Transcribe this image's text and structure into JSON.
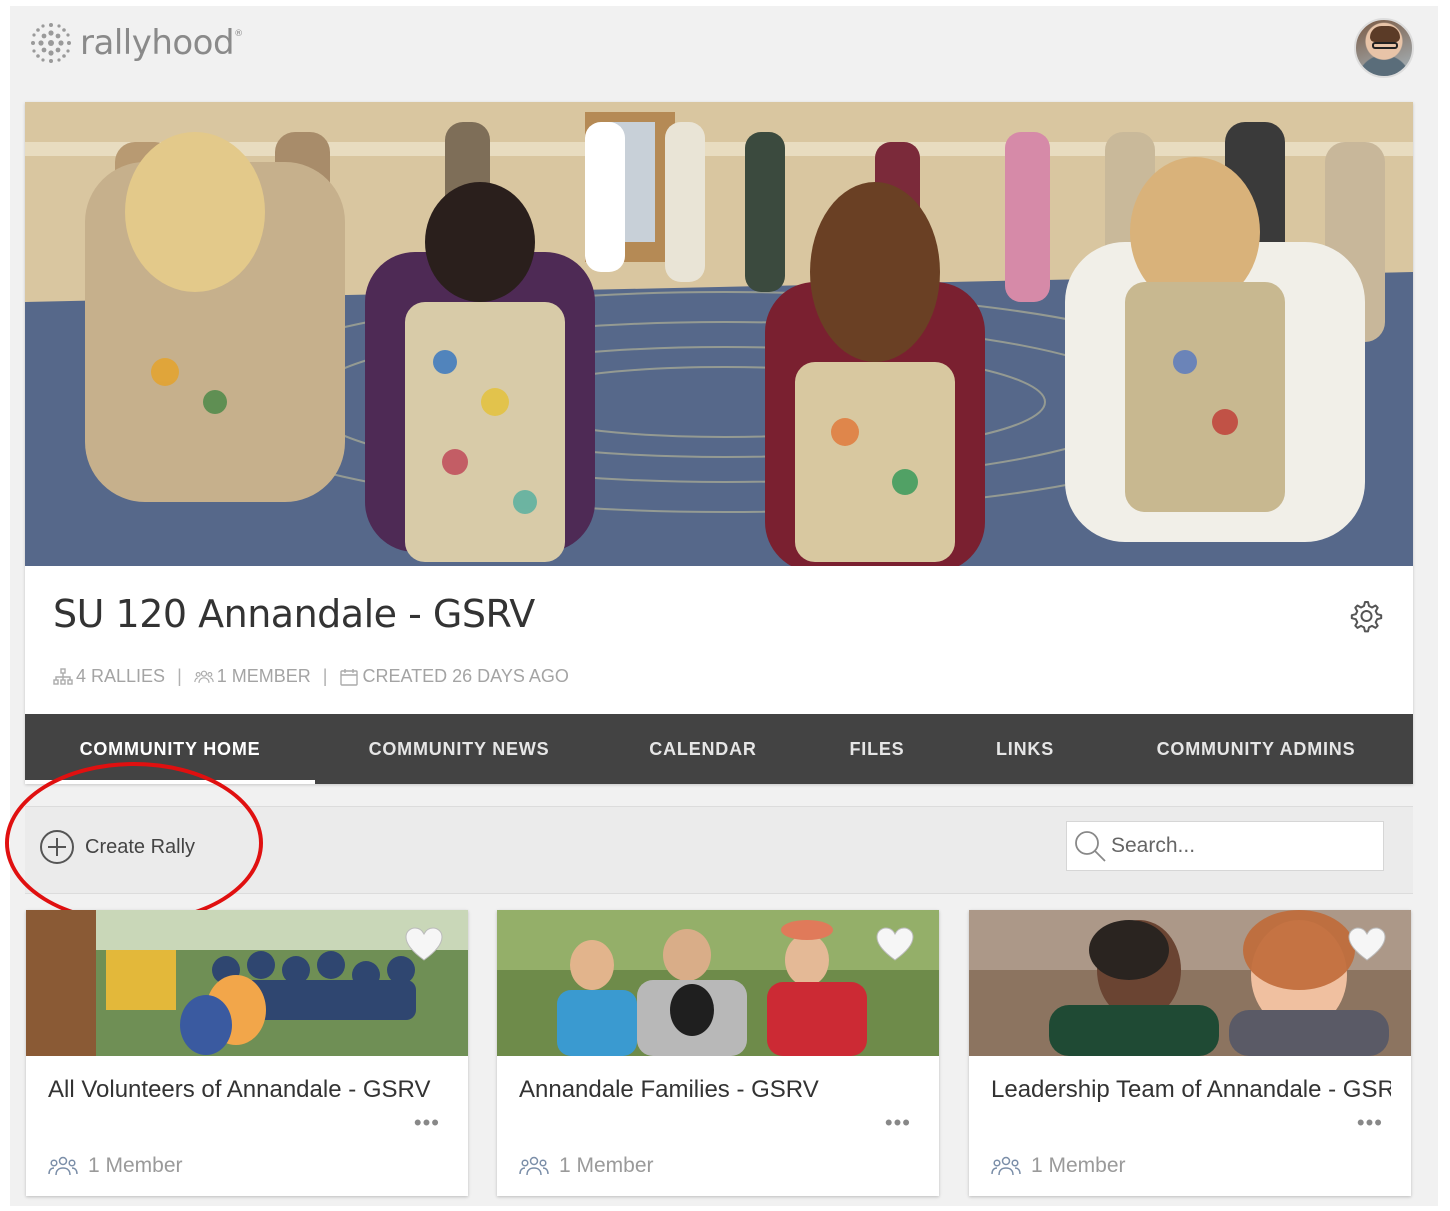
{
  "brand": {
    "name": "rallyhood",
    "mark": "®"
  },
  "community": {
    "title": "SU 120 Annandale - GSRV",
    "rallies": "4 RALLIES",
    "members": "1 MEMBER",
    "created": "CREATED 26 DAYS AGO"
  },
  "tabs": [
    {
      "label": "COMMUNITY HOME",
      "active": true
    },
    {
      "label": "COMMUNITY NEWS",
      "active": false
    },
    {
      "label": "CALENDAR",
      "active": false
    },
    {
      "label": "FILES",
      "active": false
    },
    {
      "label": "LINKS",
      "active": false
    },
    {
      "label": "COMMUNITY ADMINS",
      "active": false
    }
  ],
  "toolbar": {
    "create_label": "Create Rally",
    "search_placeholder": "Search..."
  },
  "rallies": [
    {
      "name": "All Volunteers of Annandale - GSRV",
      "members": "1 Member"
    },
    {
      "name": "Annandale Families - GSRV",
      "members": "1 Member"
    },
    {
      "name": "Leadership Team of Annandale - GSRV",
      "members": "1 Member"
    }
  ],
  "more_label": "•••",
  "colors": {
    "tab_bar": "#434343",
    "annotation": "#e01010",
    "page_bg": "#f1f1f1"
  },
  "icons": [
    "rallyhood-logo-icon",
    "gear-icon",
    "rallies-icon",
    "members-icon",
    "calendar-icon",
    "plus-circle-icon",
    "search-icon",
    "heart-icon",
    "more-icon"
  ]
}
